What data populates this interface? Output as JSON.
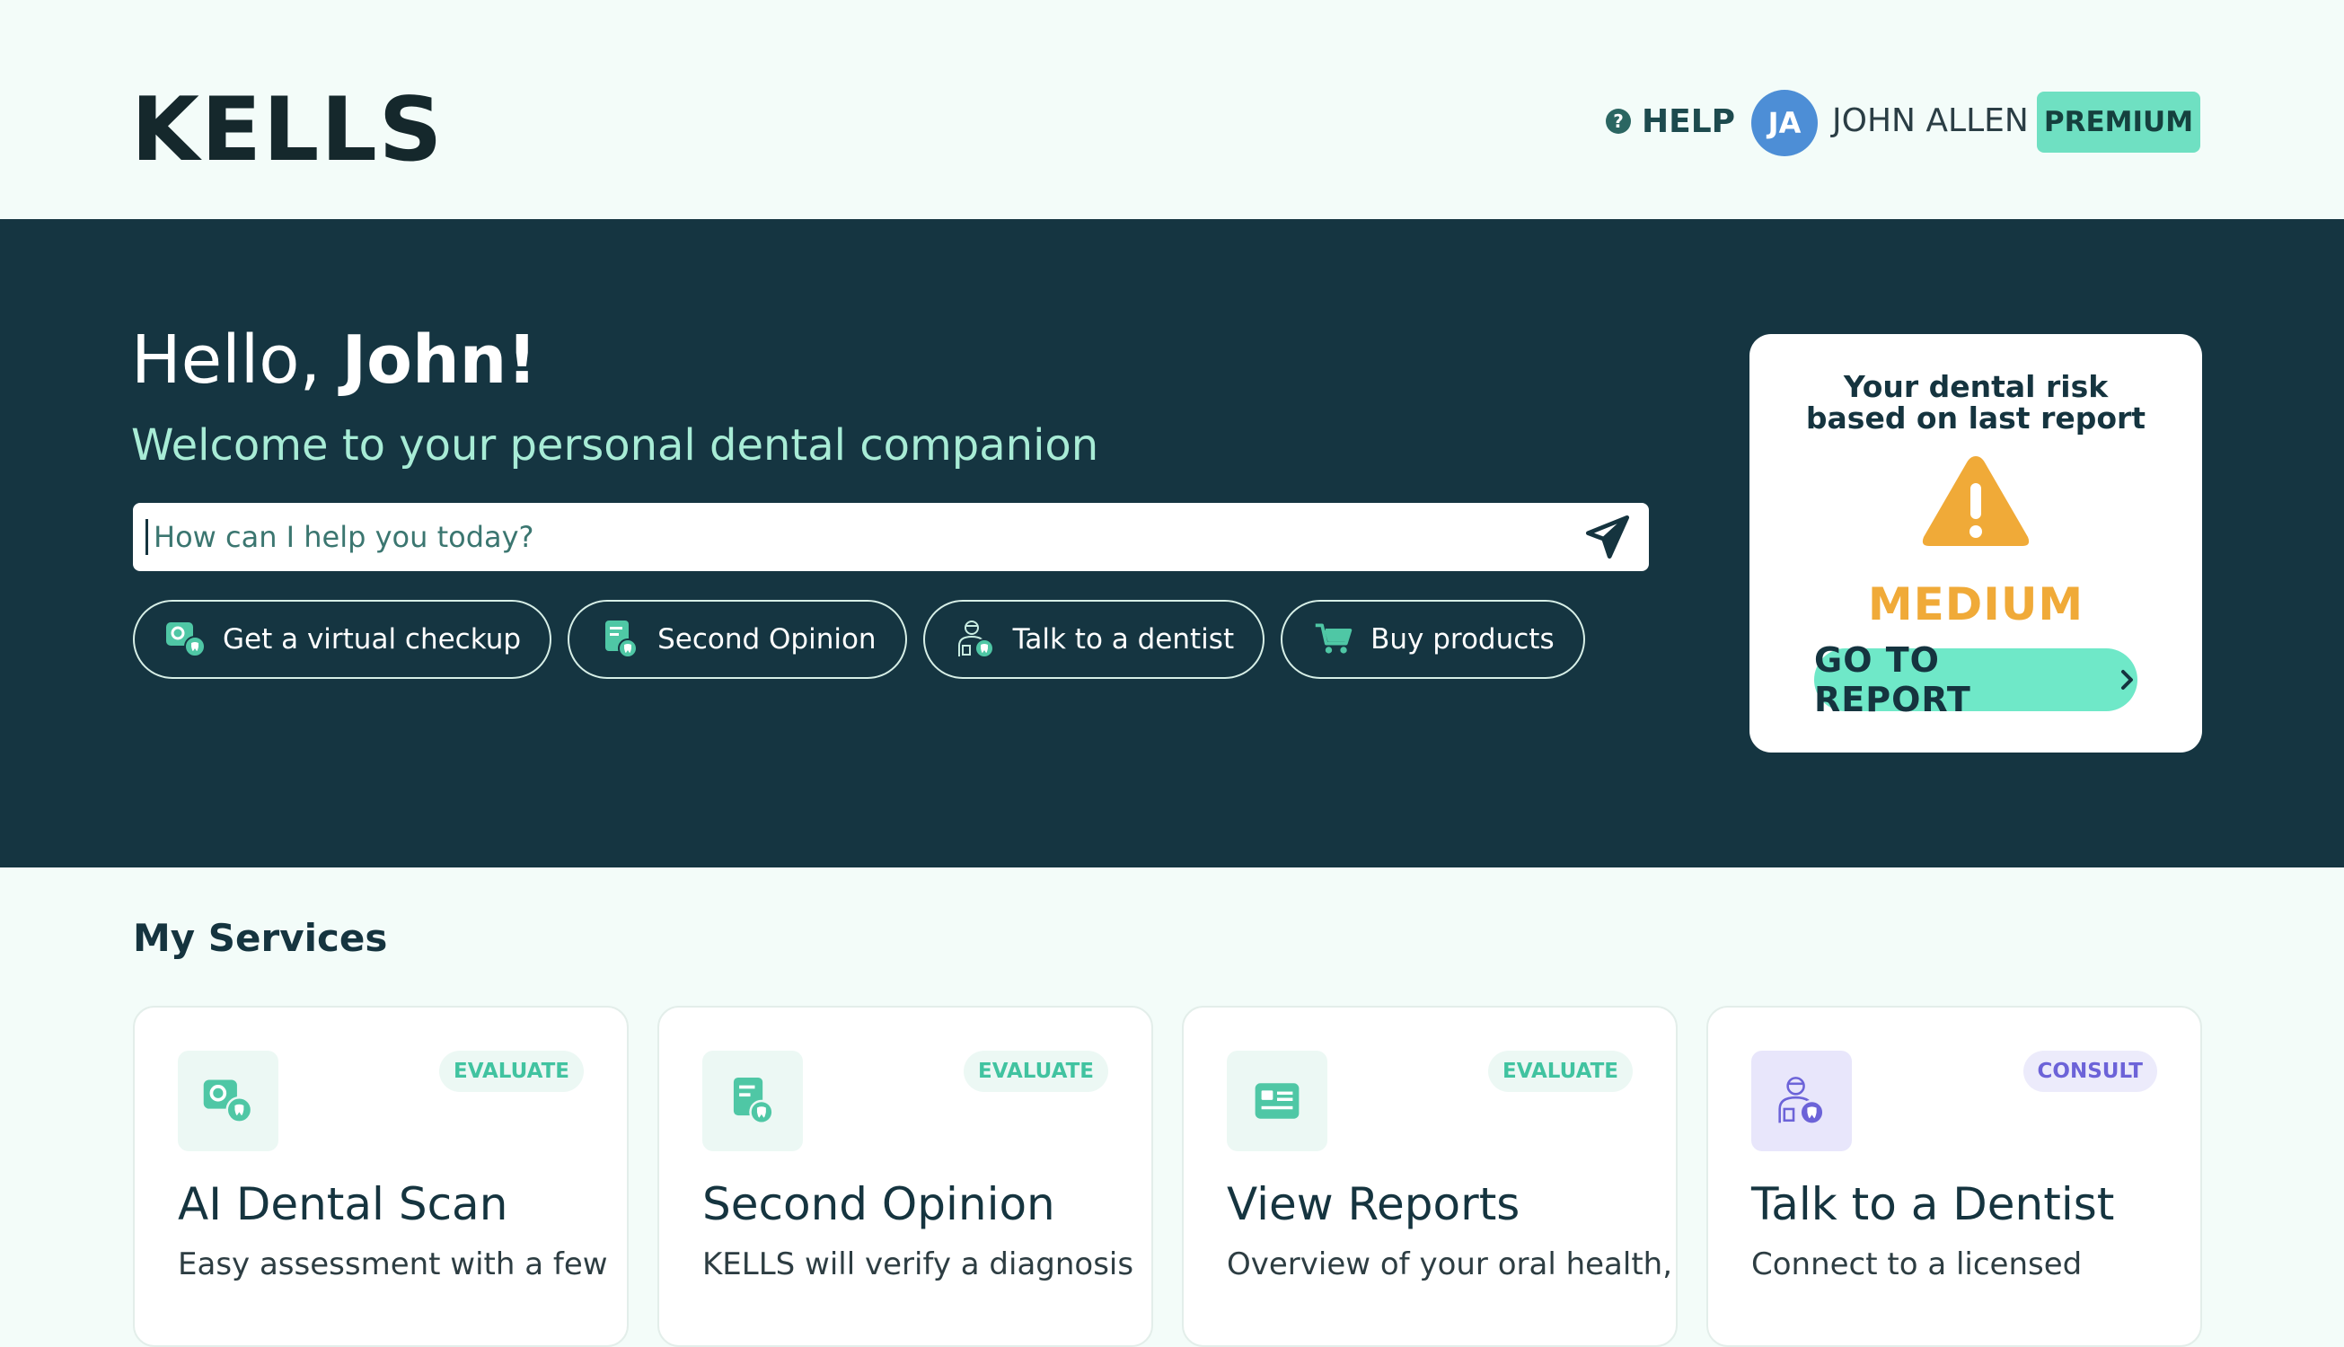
{
  "header": {
    "logo": "KELLS",
    "help_label": "HELP",
    "user": {
      "initials": "JA",
      "name": "JOHN ALLEN",
      "plan": "PREMIUM"
    }
  },
  "hero": {
    "greeting_prefix": "Hello, ",
    "greeting_name": "John!",
    "subtitle": "Welcome to your personal dental companion",
    "search": {
      "placeholder": "How can I help you today?",
      "value": ""
    },
    "chips": [
      {
        "label": "Get a virtual checkup",
        "icon": "virtual-checkup-icon"
      },
      {
        "label": "Second Opinion",
        "icon": "document-tooth-icon"
      },
      {
        "label": "Talk to a dentist",
        "icon": "dentist-icon"
      },
      {
        "label": "Buy products",
        "icon": "cart-icon"
      }
    ]
  },
  "risk": {
    "title_line1": "Your dental risk",
    "title_line2": "based on last report",
    "level": "MEDIUM",
    "button_label": "GO TO REPORT",
    "colors": {
      "warning": "#f0aa38",
      "button": "#6fe8c8"
    }
  },
  "services": {
    "title": "My Services",
    "cards": [
      {
        "title": "AI Dental Scan",
        "desc": "Easy assessment with a few",
        "tag": "EVALUATE",
        "icon": "virtual-checkup-icon"
      },
      {
        "title": "Second Opinion",
        "desc": "KELLS will verify a diagnosis",
        "tag": "EVALUATE",
        "icon": "document-tooth-icon"
      },
      {
        "title": "View Reports",
        "desc": "Overview of your oral health,",
        "tag": "EVALUATE",
        "icon": "report-card-icon"
      },
      {
        "title": "Talk to a Dentist",
        "desc": "Connect to a licensed",
        "tag": "CONSULT",
        "icon": "dentist-icon"
      }
    ]
  },
  "theme": {
    "background": "#f3fcf9",
    "hero_background": "#153541",
    "accent": "#6fe0c2",
    "purple": "#6c63d8"
  }
}
